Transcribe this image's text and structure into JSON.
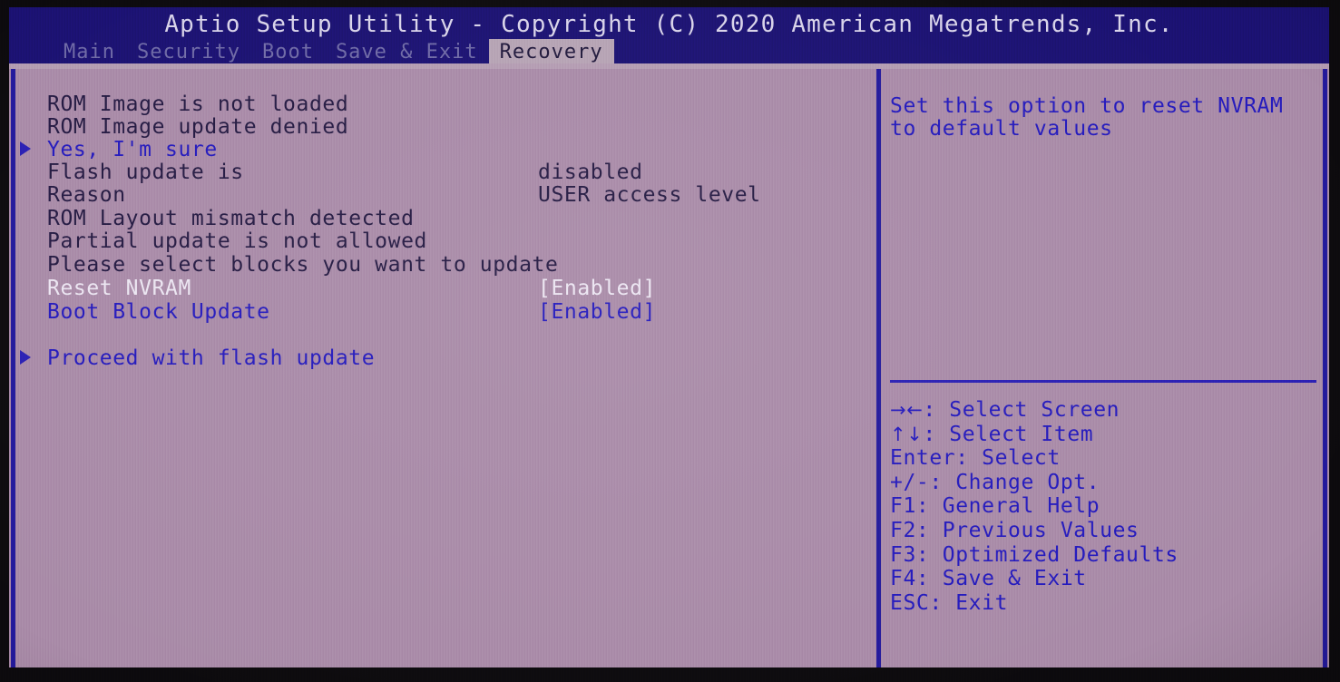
{
  "header": {
    "title": "Aptio Setup Utility - Copyright (C) 2020 American Megatrends, Inc.",
    "tabs": [
      {
        "label": "Main",
        "active": false
      },
      {
        "label": "Security",
        "active": false
      },
      {
        "label": "Boot",
        "active": false
      },
      {
        "label": "Save & Exit",
        "active": false
      },
      {
        "label": "Recovery",
        "active": true
      }
    ]
  },
  "main": {
    "rows": [
      {
        "arrow": false,
        "label": "ROM Image is not loaded",
        "value": "",
        "label_style": "c-dark",
        "value_style": "c-dark",
        "selected": false
      },
      {
        "arrow": false,
        "label": "ROM Image update denied",
        "value": "",
        "label_style": "c-dark",
        "value_style": "c-dark",
        "selected": false
      },
      {
        "arrow": true,
        "label": "Yes, I'm sure",
        "value": "",
        "label_style": "c-blue",
        "value_style": "c-blue",
        "selected": false
      },
      {
        "arrow": false,
        "label": "Flash update is",
        "value": "disabled",
        "label_style": "c-dark",
        "value_style": "c-dark",
        "selected": false
      },
      {
        "arrow": false,
        "label": "Reason",
        "value": "USER access level",
        "label_style": "c-dark",
        "value_style": "c-dark",
        "selected": false
      },
      {
        "arrow": false,
        "label": "ROM Layout mismatch detected",
        "value": "",
        "label_style": "c-dark",
        "value_style": "c-dark",
        "selected": false
      },
      {
        "arrow": false,
        "label": "Partial update is not allowed",
        "value": "",
        "label_style": "c-dark",
        "value_style": "c-dark",
        "selected": false
      },
      {
        "arrow": false,
        "label": "Please select blocks you want to update",
        "value": "",
        "label_style": "c-dark",
        "value_style": "c-dark",
        "selected": false
      },
      {
        "arrow": false,
        "label": "Reset NVRAM",
        "value": "[Enabled]",
        "label_style": "c-white",
        "value_style": "c-white",
        "selected": true
      },
      {
        "arrow": false,
        "label": "Boot Block Update",
        "value": "[Enabled]",
        "label_style": "c-blue",
        "value_style": "c-blue",
        "selected": false
      },
      {
        "arrow": true,
        "label": "Proceed with flash update",
        "value": "",
        "label_style": "c-blue",
        "value_style": "c-blue",
        "selected": false
      }
    ]
  },
  "help": {
    "description": [
      "Set this option to reset NVRAM",
      "to default values"
    ],
    "keys": [
      {
        "glyph": "→←",
        "text": ": Select Screen"
      },
      {
        "glyph": "↑↓",
        "text": ": Select Item"
      },
      {
        "glyph": "",
        "text": "Enter: Select"
      },
      {
        "glyph": "",
        "text": "+/-: Change Opt."
      },
      {
        "glyph": "",
        "text": "F1: General Help"
      },
      {
        "glyph": "",
        "text": "F2: Previous Values"
      },
      {
        "glyph": "",
        "text": "F3: Optimized Defaults"
      },
      {
        "glyph": "",
        "text": "F4: Save & Exit"
      },
      {
        "glyph": "",
        "text": "ESC: Exit"
      }
    ]
  },
  "colors": {
    "titlebar_blue": "#1b1172",
    "screen_background": "#a98ba8",
    "frame_blue": "#231a9c",
    "text_blue": "#241abd",
    "text_dark": "#241a42",
    "text_highlight": "#ece6f2",
    "tab_active_background": "#b6a3b4"
  }
}
